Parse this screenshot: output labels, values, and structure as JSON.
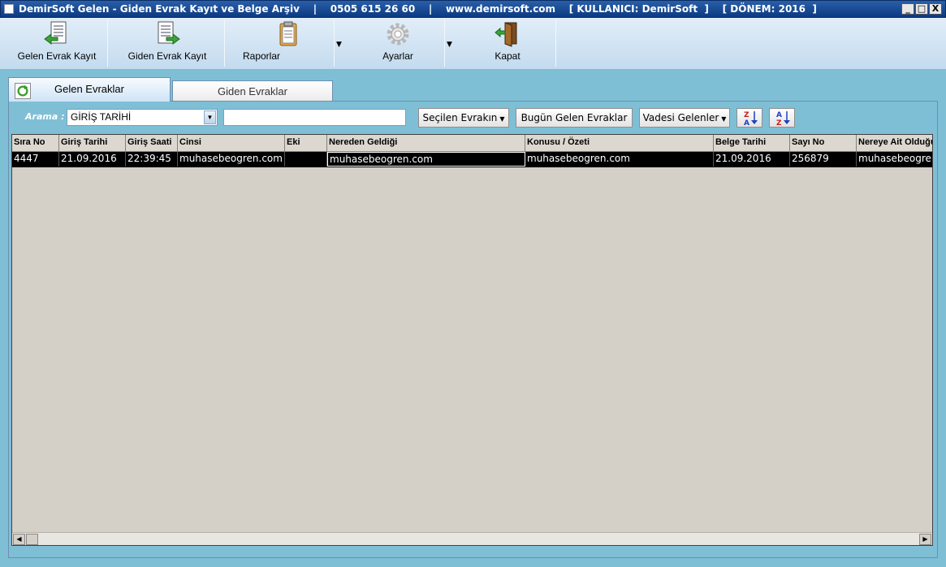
{
  "window": {
    "title": "DemirSoft Gelen - Giden Evrak Kayıt ve Belge Arşiv    |    0505 615 26 60    |    www.demirsoft.com    [ KULLANICI: DemirSoft  ]    [ DÖNEM: 2016  ]",
    "min": "_",
    "max": "□",
    "close": "X"
  },
  "toolbar": {
    "gelen_label": "Gelen Evrak Kayıt",
    "giden_label": "Giden Evrak Kayıt",
    "raporlar_label": "Raporlar",
    "ayarlar_label": "Ayarlar",
    "kapat_label": "Kapat",
    "drop_glyph": "▼"
  },
  "tabs": {
    "gelen": "Gelen Evraklar",
    "giden": "Giden Evraklar"
  },
  "search": {
    "label": "Arama :",
    "field_value": "GİRİŞ TARİHİ",
    "query": "",
    "secilen_label": "Seçilen Evrakın",
    "bugun_label": "Bugün Gelen Evraklar",
    "vadesi_label": "Vadesi Gelenler"
  },
  "grid": {
    "columns": [
      "Sıra No",
      "Giriş Tarihi",
      "Giriş Saati",
      "Cinsi",
      "Eki",
      "Nereden Geldiği",
      "Konusu / Özeti",
      "Belge Tarihi",
      "Sayı No",
      "Nereye Ait Olduğu"
    ],
    "rows": [
      [
        "4447",
        "21.09.2016",
        "22:39:45",
        "muhasebeogren.com",
        "",
        "muhasebeogren.com",
        "muhasebeogren.com",
        "21.09.2016",
        "256879",
        "muhasebeogren.com"
      ]
    ]
  },
  "scroll": {
    "left": "◀",
    "right": "▶"
  }
}
